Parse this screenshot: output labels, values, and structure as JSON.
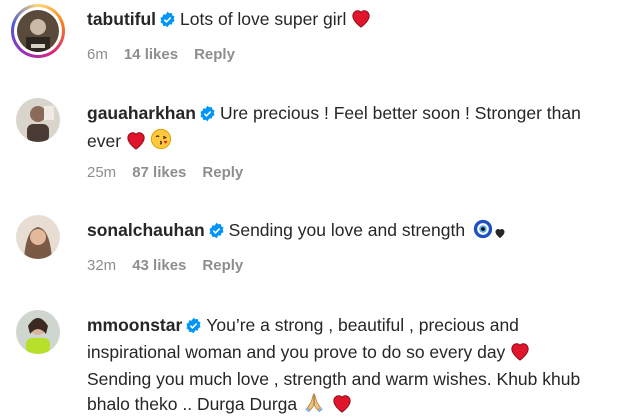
{
  "comments": [
    {
      "username": "tabutiful",
      "text": "Lots of love super girl",
      "time": "6m",
      "likes": "14 likes",
      "reply": "Reply"
    },
    {
      "username": "gauaharkhan",
      "text_line1": "Ure precious ! Feel better soon ! Stronger than",
      "text_line2": "ever",
      "time": "25m",
      "likes": "87 likes",
      "reply": "Reply"
    },
    {
      "username": "sonalchauhan",
      "text": "Sending you love and strength",
      "time": "32m",
      "likes": "43 likes",
      "reply": "Reply"
    },
    {
      "username": "mmoonstar",
      "text_line1": "You’re a strong , beautiful , precious and",
      "text_line2": "inspirational woman and you prove to do so every day",
      "text_line3": "Sending you much love , strength and warm wishes. Khub khub",
      "text_line4": "bhalo theko .. Durga Durga"
    }
  ],
  "colors": {
    "verified_blue": "#0095f6",
    "heart_red": "#e0142b",
    "meta_grey": "#8e8e8e",
    "text_dark": "#262626"
  },
  "icons": [
    "verified-badge-icon",
    "heart-icon",
    "kissing-face-icon",
    "evil-eye-icon",
    "black-heart-icon",
    "folded-hands-icon"
  ]
}
